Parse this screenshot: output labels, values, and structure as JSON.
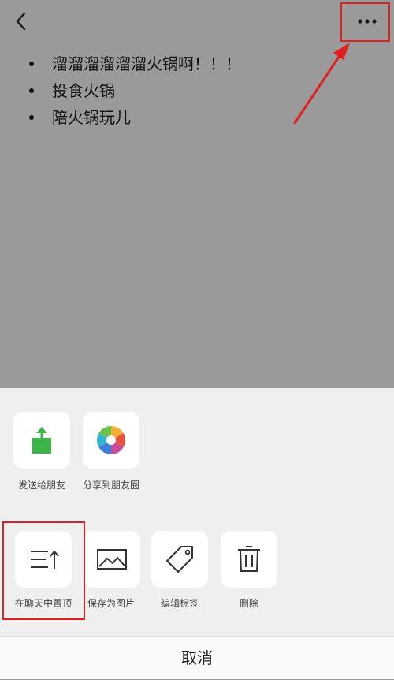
{
  "header": {
    "back_icon": "chevron-left-icon",
    "more_icon": "more-horizontal-icon"
  },
  "note": {
    "items": [
      "溜溜溜溜溜溜火锅啊！！！",
      "投食火锅",
      "陪火锅玩儿"
    ]
  },
  "share_row": {
    "items": [
      {
        "label": "发送给朋友",
        "icon": "send-to-friend-icon"
      },
      {
        "label": "分享到朋友圈",
        "icon": "moments-icon"
      }
    ]
  },
  "action_row": {
    "items": [
      {
        "label": "在聊天中置顶",
        "icon": "pin-to-top-icon"
      },
      {
        "label": "保存为图片",
        "icon": "image-icon"
      },
      {
        "label": "编辑标签",
        "icon": "tag-icon"
      },
      {
        "label": "删除",
        "icon": "trash-icon"
      }
    ]
  },
  "cancel_label": "取消",
  "colors": {
    "annotation_red": "#e02020",
    "share_green": "#3cb54a",
    "overlay_gray": "#9a9a9a"
  }
}
